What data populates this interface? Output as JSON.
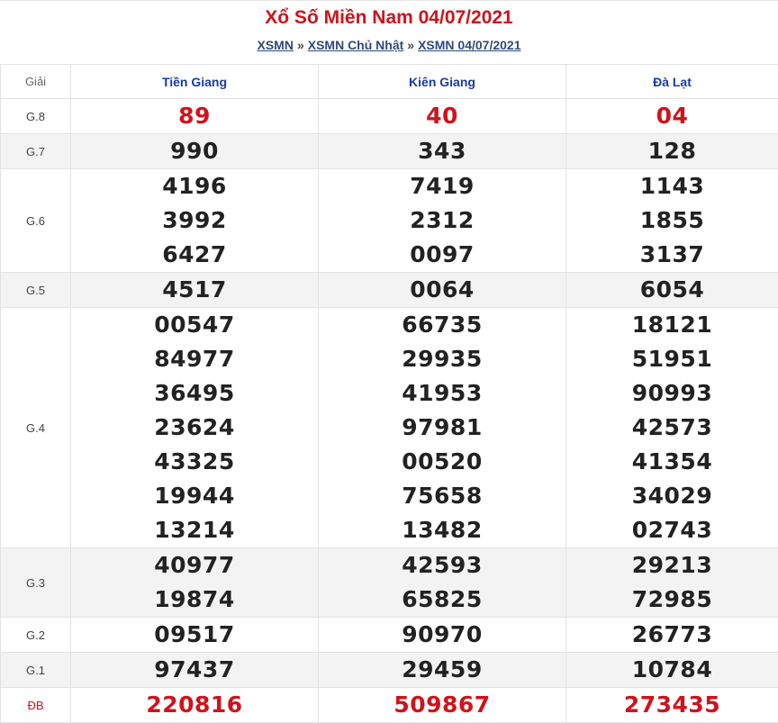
{
  "header": {
    "title": "Xổ Số Miền Nam 04/07/2021",
    "breadcrumb": [
      "XSMN",
      "XSMN Chủ Nhật",
      "XSMN 04/07/2021"
    ],
    "separator": "»"
  },
  "table": {
    "label_header": "Giải",
    "provinces": [
      "Tiền Giang",
      "Kiên Giang",
      "Đà Lạt"
    ],
    "prizes": [
      {
        "label": "G.8",
        "values": [
          [
            "89"
          ],
          [
            "40"
          ],
          [
            "04"
          ]
        ]
      },
      {
        "label": "G.7",
        "values": [
          [
            "990"
          ],
          [
            "343"
          ],
          [
            "128"
          ]
        ]
      },
      {
        "label": "G.6",
        "values": [
          [
            "4196",
            "3992",
            "6427"
          ],
          [
            "7419",
            "2312",
            "0097"
          ],
          [
            "1143",
            "1855",
            "3137"
          ]
        ]
      },
      {
        "label": "G.5",
        "values": [
          [
            "4517"
          ],
          [
            "0064"
          ],
          [
            "6054"
          ]
        ]
      },
      {
        "label": "G.4",
        "values": [
          [
            "00547",
            "84977",
            "36495",
            "23624",
            "43325",
            "19944",
            "13214"
          ],
          [
            "66735",
            "29935",
            "41953",
            "97981",
            "00520",
            "75658",
            "13482"
          ],
          [
            "18121",
            "51951",
            "90993",
            "42573",
            "41354",
            "34029",
            "02743"
          ]
        ]
      },
      {
        "label": "G.3",
        "values": [
          [
            "40977",
            "19874"
          ],
          [
            "42593",
            "65825"
          ],
          [
            "29213",
            "72985"
          ]
        ]
      },
      {
        "label": "G.2",
        "values": [
          [
            "09517"
          ],
          [
            "90970"
          ],
          [
            "26773"
          ]
        ]
      },
      {
        "label": "G.1",
        "values": [
          [
            "97437"
          ],
          [
            "29459"
          ],
          [
            "10784"
          ]
        ]
      },
      {
        "label": "ĐB",
        "values": [
          [
            "220816"
          ],
          [
            "509867"
          ],
          [
            "273435"
          ]
        ]
      }
    ]
  },
  "colors": {
    "title": "#d1121a",
    "link": "#2e4a7d",
    "province": "#1a3aa8",
    "highlight": "#d1121a",
    "number": "#222222",
    "alt_row": "#f3f3f3"
  }
}
